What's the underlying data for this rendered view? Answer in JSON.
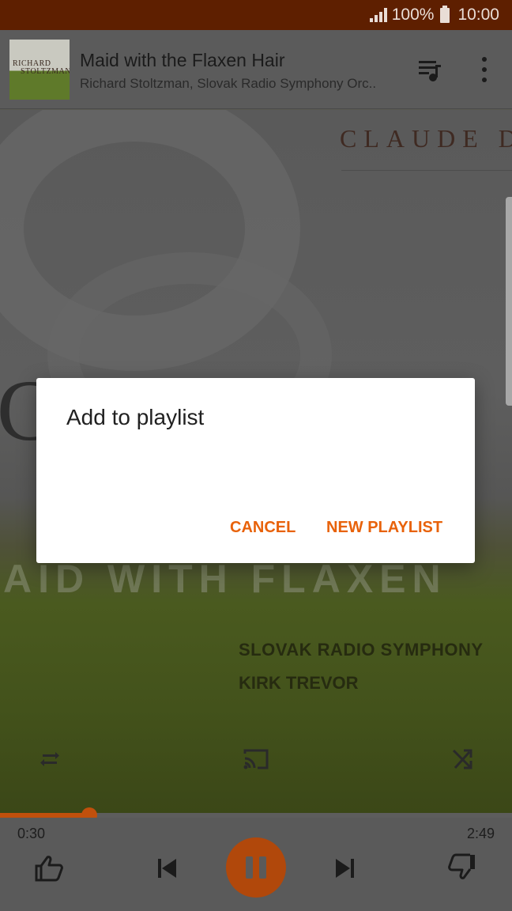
{
  "status_bar": {
    "battery": "100%",
    "time": "10:00"
  },
  "now_playing": {
    "title": "Maid with the Flaxen Hair",
    "subtitle": "Richard Stoltzman, Slovak Radio Symphony Orc..",
    "thumbnail_text_1": "RICHARD",
    "thumbnail_text_2": "STOLTZMAN"
  },
  "album_art": {
    "composer_text": "CLAUDE D",
    "big_text": "C",
    "title_text": "AID WITH FLAXEN",
    "credit_1": "SLOVAK RADIO SYMPHONY",
    "credit_2": "KIRK TREVOR"
  },
  "dialog": {
    "title": "Add to playlist",
    "cancel_label": "CANCEL",
    "new_playlist_label": "NEW PLAYLIST"
  },
  "playback": {
    "elapsed": "0:30",
    "total": "2:49",
    "progress_fraction": 0.174
  },
  "icons": {
    "queue": "queue-music-icon",
    "more": "more-vert-icon",
    "repeat": "repeat-icon",
    "cast": "cast-icon",
    "shuffle": "shuffle-icon",
    "thumb_up": "thumb-up-icon",
    "previous": "skip-previous-icon",
    "pause": "pause-icon",
    "next": "skip-next-icon",
    "thumb_down": "thumb-down-icon"
  },
  "colors": {
    "status_bar": "#5e1f00",
    "accent": "#e8620a",
    "play_button": "#b1480b"
  }
}
